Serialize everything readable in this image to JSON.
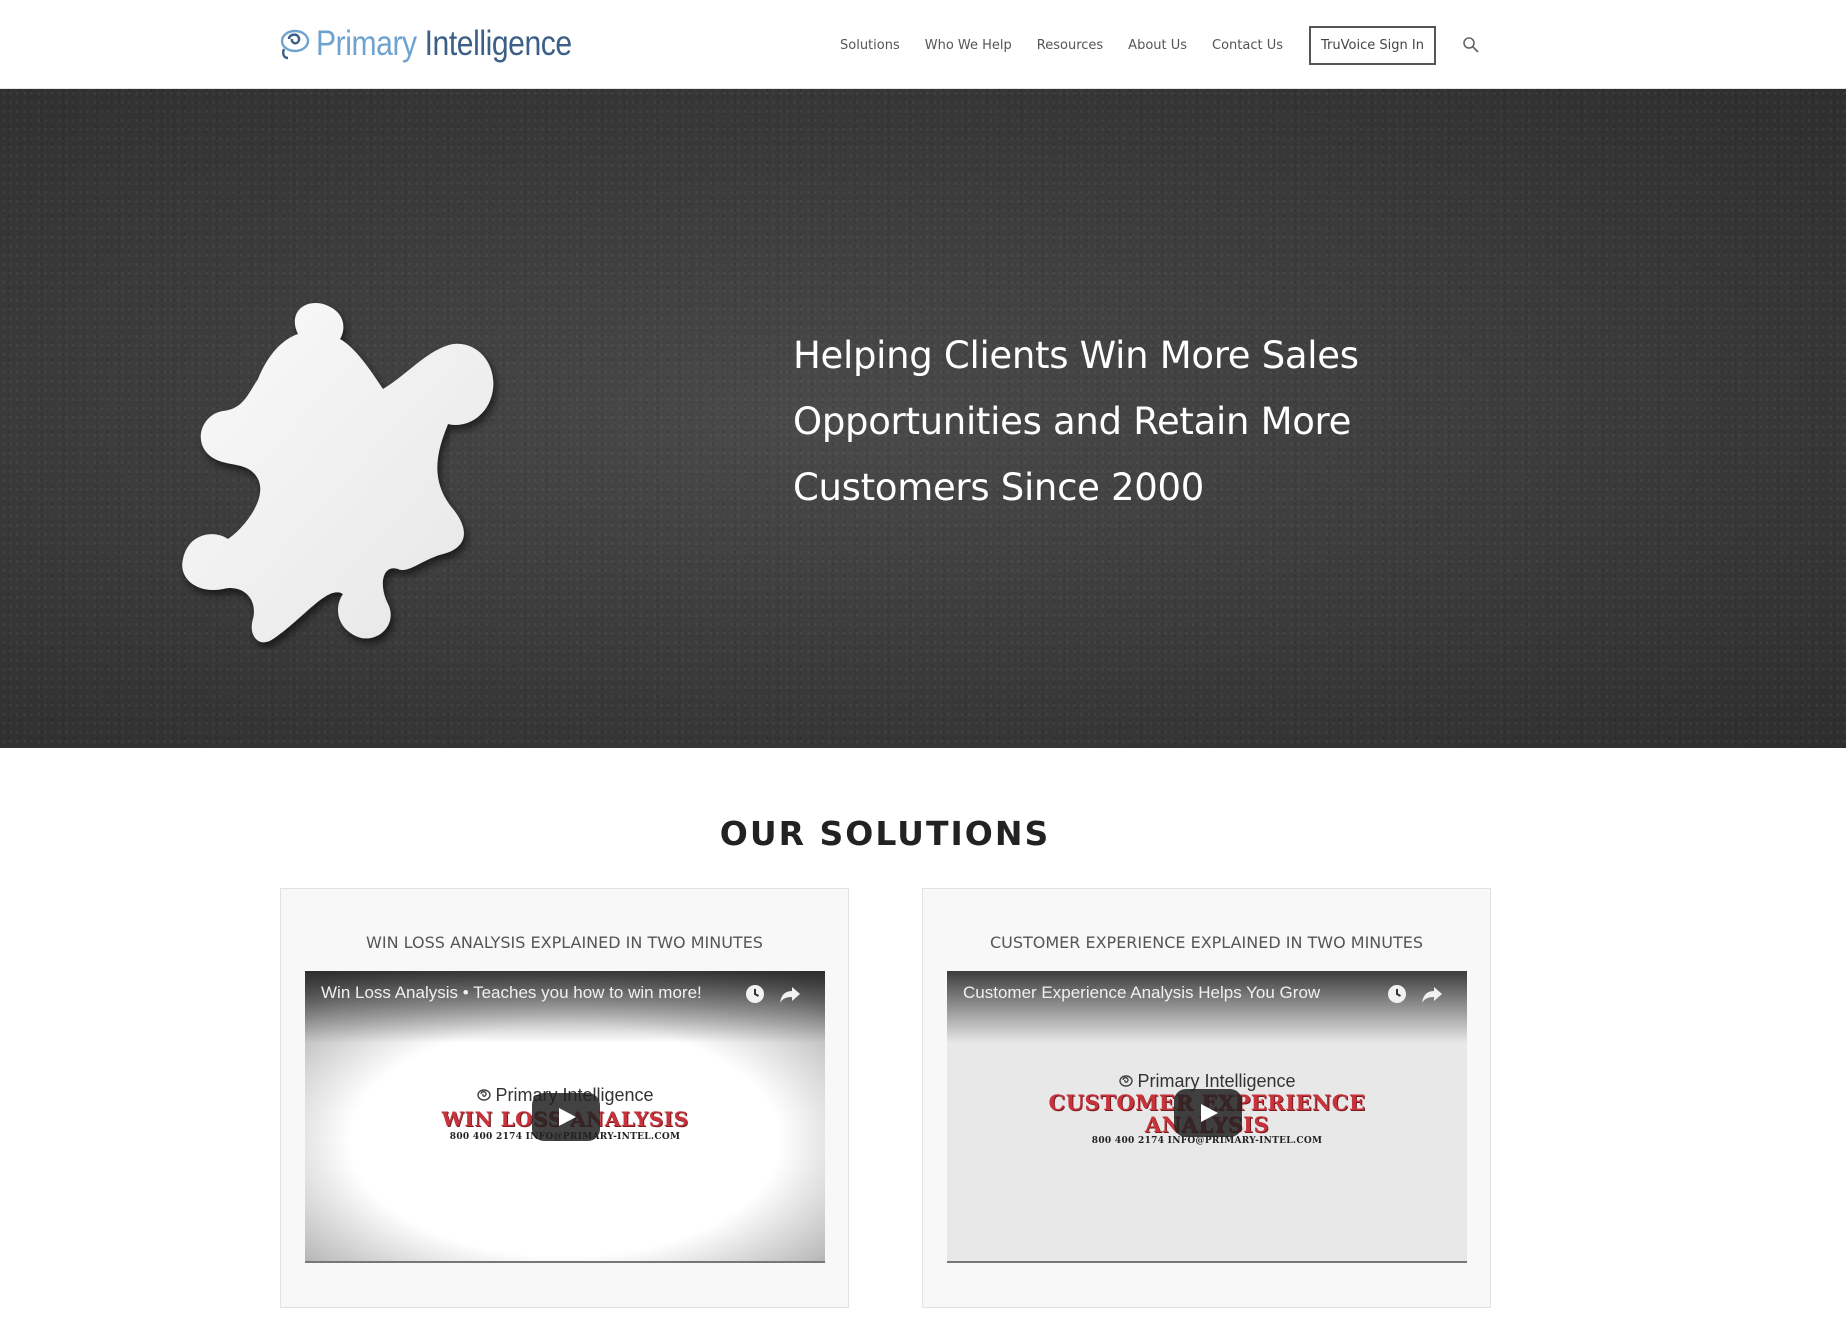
{
  "header": {
    "logo": {
      "word1": "Primary",
      "word2": "Intelligence"
    },
    "nav": [
      "Solutions",
      "Who We Help",
      "Resources",
      "About Us",
      "Contact Us"
    ],
    "signin_label": "TruVoice Sign In",
    "search_icon": "search-icon"
  },
  "hero": {
    "lines": [
      "Helping Clients Win More Sales",
      "Opportunities and Retain More",
      "Customers Since 2000"
    ],
    "image": "white-puzzle-piece"
  },
  "solutions": {
    "title": "OUR SOLUTIONS",
    "cards": [
      {
        "title": "WIN LOSS ANALYSIS EXPLAINED IN TWO MINUTES",
        "video_title": "Win Loss Analysis • Teaches you how to win more!",
        "thumb_brand": "Primary Intelligence",
        "thumb_headline": "WIN LOSS ANALYSIS",
        "thumb_contact": "800 400 2174   INFO@PRIMARY-INTEL.COM"
      },
      {
        "title": "CUSTOMER EXPERIENCE EXPLAINED IN TWO MINUTES",
        "video_title": "Customer Experience Analysis Helps You Grow",
        "thumb_brand": "Primary Intelligence",
        "thumb_headline_1": "CUSTOMER EXPERIENCE",
        "thumb_headline_2": "ANALYSIS",
        "thumb_contact": "800 400 2174   INFO@PRIMARY-INTEL.COM"
      }
    ]
  },
  "colors": {
    "logo_light": "#6fa3cf",
    "logo_dark": "#3b5f86",
    "hero_bg": "#3d3d3d",
    "thumb_red": "#c8323b"
  }
}
